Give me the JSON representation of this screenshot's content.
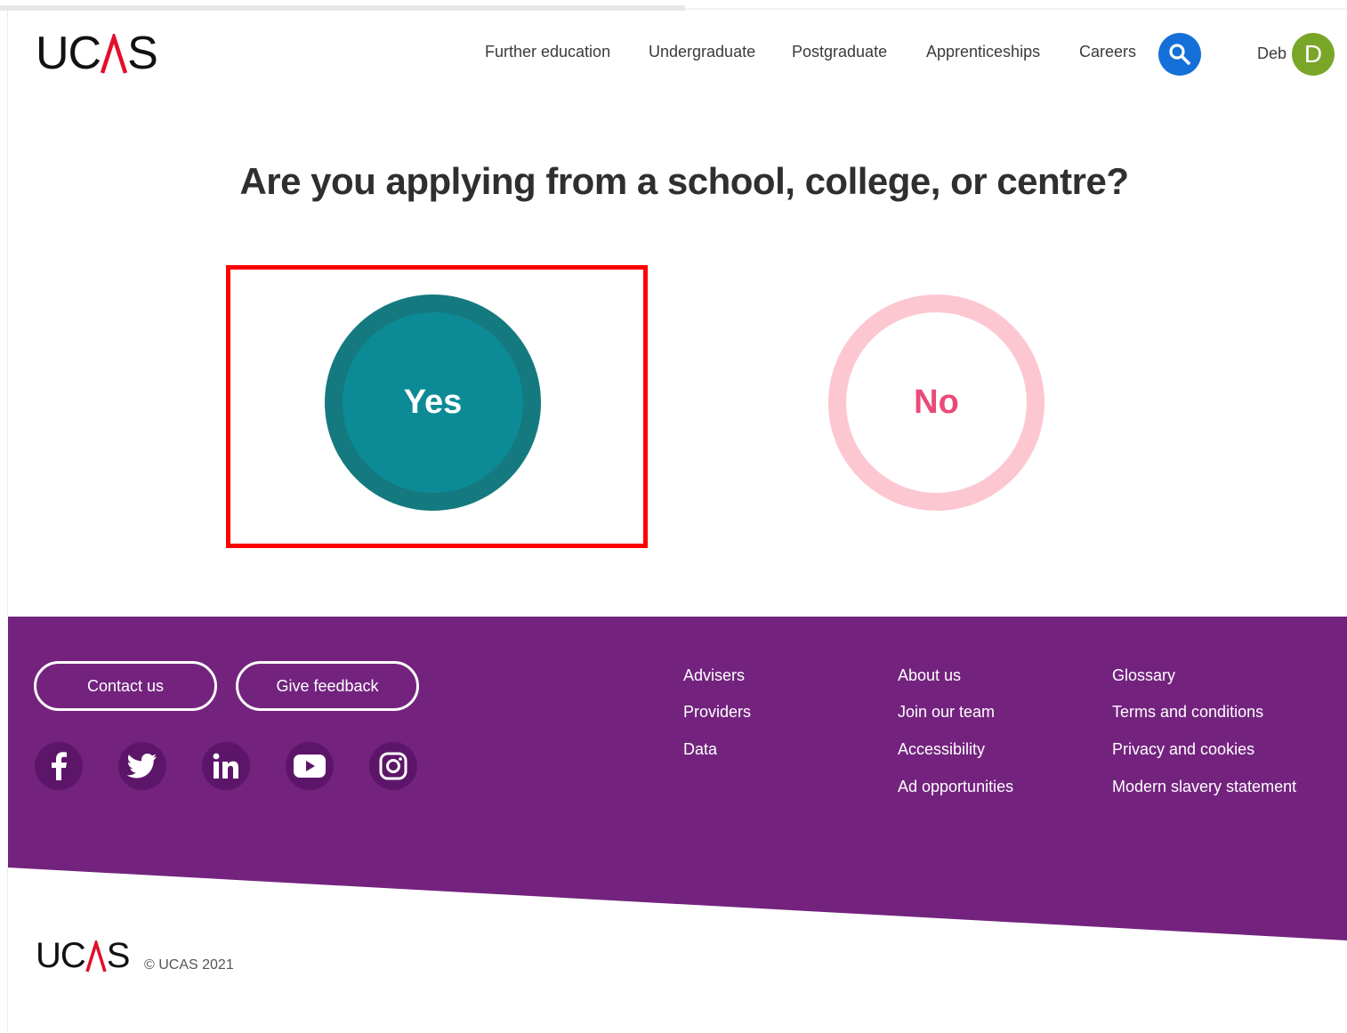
{
  "header": {
    "logo_text_left": "UC",
    "logo_text_right": "S",
    "nav": [
      {
        "label": "Further education"
      },
      {
        "label": "Undergraduate"
      },
      {
        "label": "Postgraduate"
      },
      {
        "label": "Apprenticeships"
      },
      {
        "label": "Careers"
      }
    ],
    "user_name": "Deb",
    "avatar_initial": "D",
    "search_icon": "search-icon"
  },
  "main": {
    "question": "Are you applying from a school, college, or centre?",
    "yes_label": "Yes",
    "no_label": "No"
  },
  "footer": {
    "buttons": {
      "contact": "Contact us",
      "feedback": "Give feedback"
    },
    "social": [
      "facebook-icon",
      "twitter-icon",
      "linkedin-icon",
      "youtube-icon",
      "instagram-icon"
    ],
    "columns": [
      [
        "Advisers",
        "Providers",
        "Data"
      ],
      [
        "About us",
        "Join our team",
        "Accessibility",
        "Ad opportunities"
      ],
      [
        "Glossary",
        "Terms and conditions",
        "Privacy and cookies",
        "Modern slavery statement"
      ]
    ],
    "logo_text_left": "UC",
    "logo_text_right": "S",
    "copyright": "© UCAS 2021"
  },
  "colors": {
    "footer_purple": "#73237e",
    "yes_teal": "#0c8b96",
    "no_pink": "#fcc7d1",
    "accent_red": "#e1102b",
    "search_blue": "#1470d8",
    "avatar_green": "#79a629"
  }
}
